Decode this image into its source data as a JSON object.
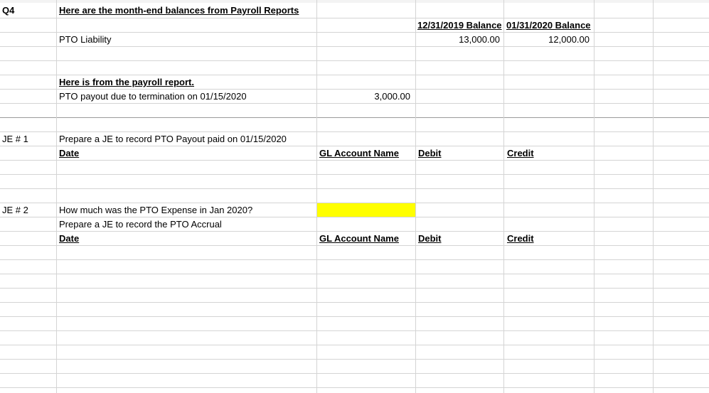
{
  "sheet": {
    "q4_label": "Q4",
    "header_title": "Here are the month-end balances from Payroll Reports",
    "col_header_2019": "12/31/2019 Balance",
    "col_header_2020": "01/31/2020 Balance",
    "pto_liability_label": "PTO Liability",
    "pto_liability_2019": "13,000.00",
    "pto_liability_2020": "12,000.00",
    "payroll_report_heading": "Here is from the payroll report.",
    "pto_payout_desc": "PTO payout due to termination on 01/15/2020",
    "pto_payout_amount": "3,000.00",
    "je1": {
      "label": "JE # 1",
      "prompt": "Prepare a JE to record PTO Payout paid on 01/15/2020",
      "date_header": "Date",
      "gl_header": "GL Account Name",
      "debit_header": "Debit",
      "credit_header": "Credit"
    },
    "je2": {
      "label": "JE # 2",
      "question": "How much was the PTO Expense in Jan 2020?",
      "prompt": "Prepare a JE to record the PTO Accrual",
      "date_header": "Date",
      "gl_header": "GL Account Name",
      "debit_header": "Debit",
      "credit_header": "Credit"
    },
    "highlight_color": "#ffff00"
  }
}
